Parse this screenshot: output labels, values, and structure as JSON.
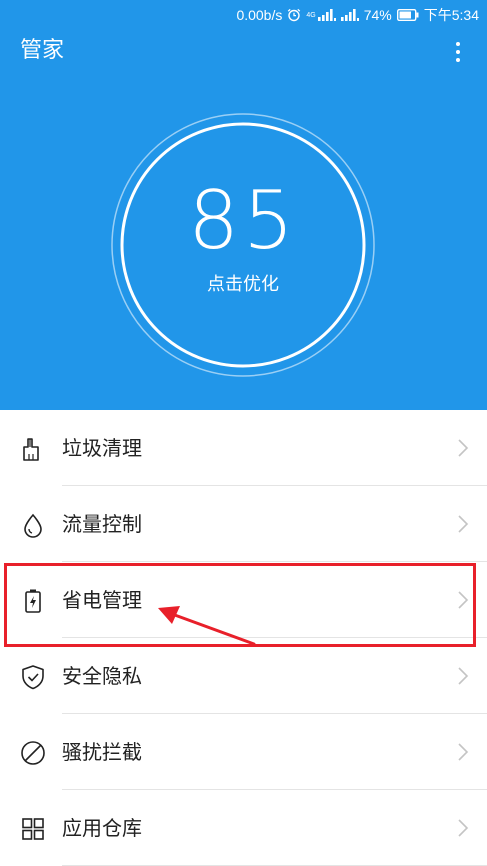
{
  "status_bar": {
    "speed": "0.00b/s",
    "network": "4G",
    "battery_percent": "74%",
    "time": "下午5:34"
  },
  "header": {
    "title": "管家",
    "background_color": "#2196e9"
  },
  "score": {
    "value": "85",
    "action_label": "点击优化"
  },
  "menu": {
    "items": [
      {
        "label": "垃圾清理",
        "icon": "broom-icon"
      },
      {
        "label": "流量控制",
        "icon": "droplet-icon"
      },
      {
        "label": "省电管理",
        "icon": "battery-icon"
      },
      {
        "label": "安全隐私",
        "icon": "shield-check-icon"
      },
      {
        "label": "骚扰拦截",
        "icon": "block-icon"
      },
      {
        "label": "应用仓库",
        "icon": "grid-icon"
      }
    ]
  },
  "annotation": {
    "highlight_color": "#e8202a",
    "highlighted_item": "省电管理"
  }
}
